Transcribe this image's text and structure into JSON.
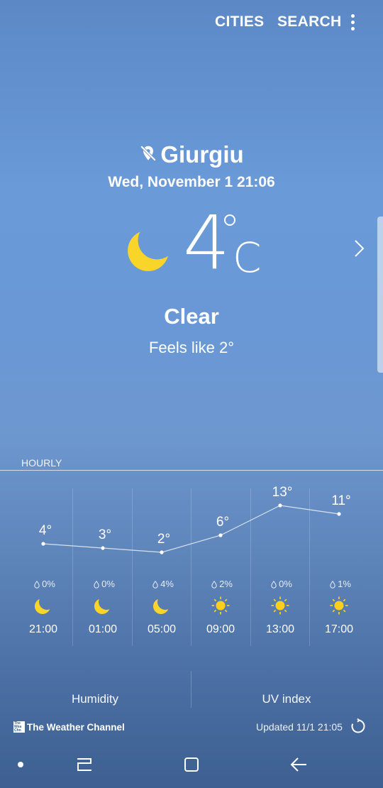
{
  "header": {
    "cities_label": "CITIES",
    "search_label": "SEARCH",
    "menu_icon": "more-vert-icon"
  },
  "location": {
    "city": "Giurgiu",
    "icon": "location-off-icon",
    "datetime": "Wed, November 1 21:06"
  },
  "current": {
    "temp": "4",
    "unit": "C",
    "degree_symbol": "°",
    "condition": "Clear",
    "feels_like": "Feels like 2°",
    "icon": "moon-icon"
  },
  "hourly": {
    "label": "HOURLY",
    "items": [
      {
        "temp": "4°",
        "temp_value": 4,
        "precip": "0%",
        "icon": "moon-icon",
        "time": "21:00"
      },
      {
        "temp": "3°",
        "temp_value": 3,
        "precip": "0%",
        "icon": "moon-icon",
        "time": "01:00"
      },
      {
        "temp": "2°",
        "temp_value": 2,
        "precip": "4%",
        "icon": "moon-icon",
        "time": "05:00"
      },
      {
        "temp": "6°",
        "temp_value": 6,
        "precip": "2%",
        "icon": "sun-icon",
        "time": "09:00"
      },
      {
        "temp": "13°",
        "temp_value": 13,
        "precip": "0%",
        "icon": "sun-icon",
        "time": "13:00"
      },
      {
        "temp": "11°",
        "temp_value": 11,
        "precip": "1%",
        "icon": "sun-icon",
        "time": "17:00"
      }
    ]
  },
  "cards": {
    "humidity_label": "Humidity",
    "uv_label": "UV index"
  },
  "footer": {
    "provider": "The Weather Channel",
    "logo_text": "The Weather Channel",
    "updated": "Updated  11/1  21:05",
    "refresh_icon": "refresh-icon"
  },
  "navbar": {
    "dot": "nav-dot",
    "recent": "recent-apps-icon",
    "home": "home-icon",
    "back": "back-icon"
  },
  "colors": {
    "moon": "#f9d52a",
    "sun": "#fbcf1c",
    "text": "#ffffff"
  }
}
